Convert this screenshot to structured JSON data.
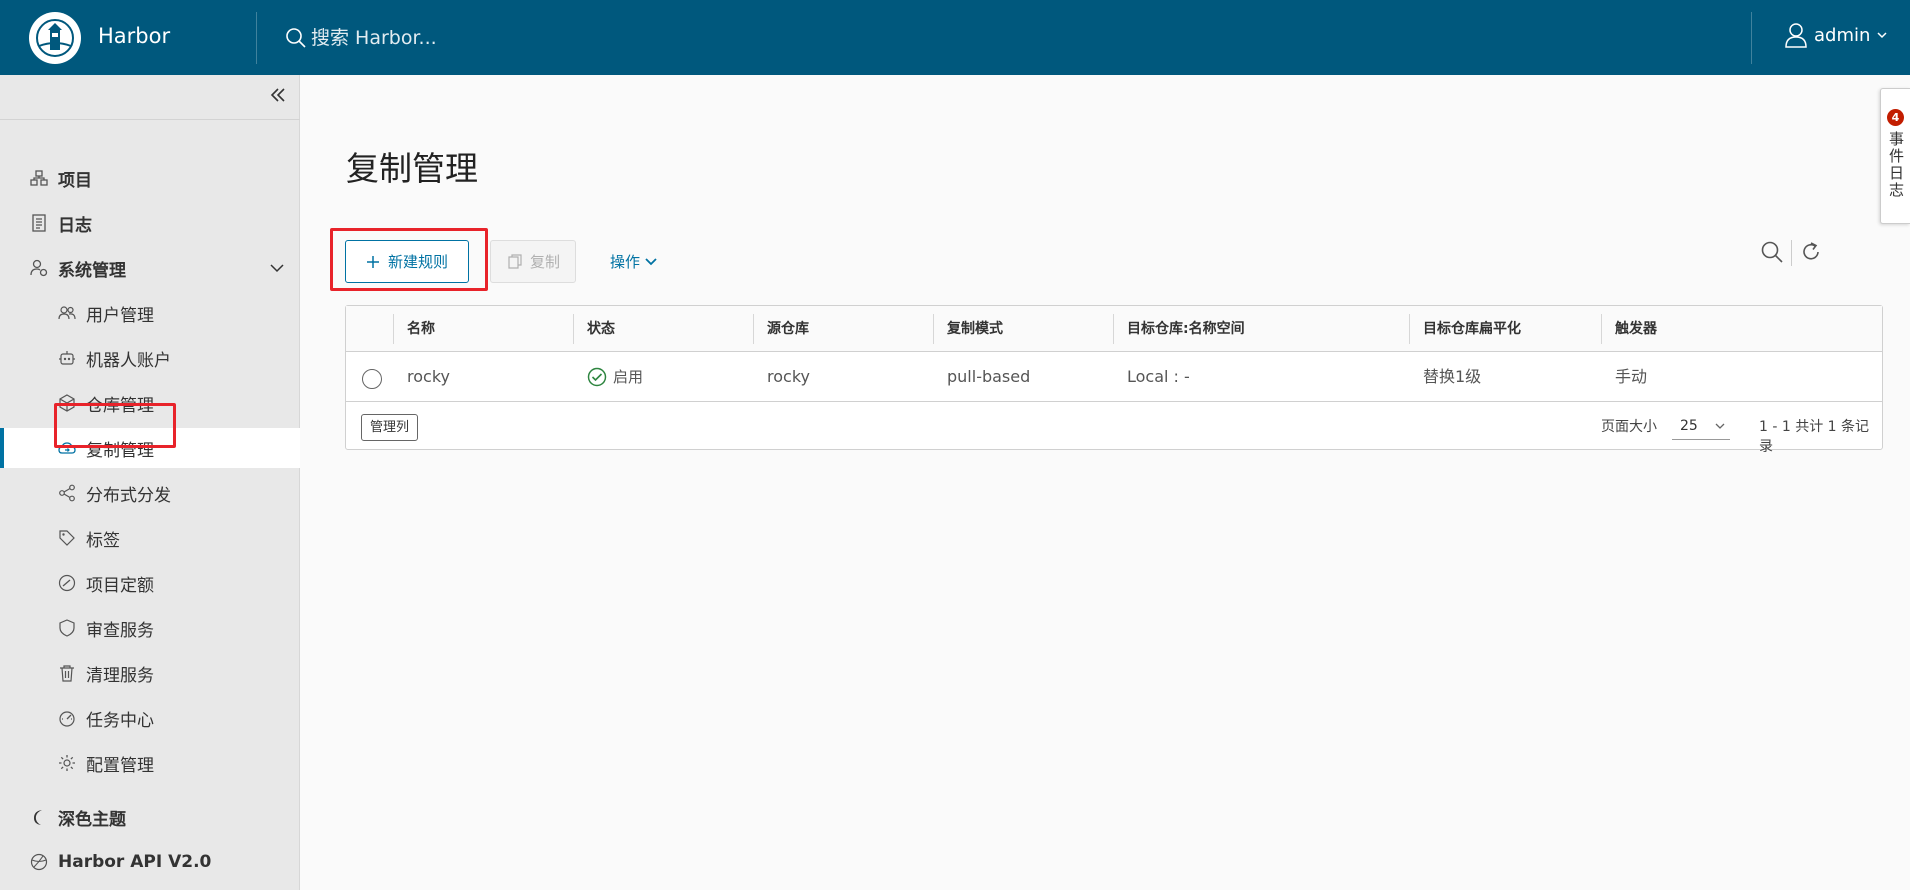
{
  "header": {
    "brand": "Harbor",
    "search_placeholder": "搜索 Harbor...",
    "user": "admin"
  },
  "sidebar": {
    "top": [
      {
        "label": "项目"
      },
      {
        "label": "日志"
      },
      {
        "label": "系统管理"
      }
    ],
    "sub": [
      {
        "label": "用户管理"
      },
      {
        "label": "机器人账户"
      },
      {
        "label": "仓库管理"
      },
      {
        "label": "复制管理"
      },
      {
        "label": "分布式分发"
      },
      {
        "label": "标签"
      },
      {
        "label": "项目定额"
      },
      {
        "label": "审查服务"
      },
      {
        "label": "清理服务"
      },
      {
        "label": "任务中心"
      },
      {
        "label": "配置管理"
      }
    ],
    "bottom": [
      {
        "label": "深色主题"
      },
      {
        "label": "Harbor API V2.0"
      }
    ]
  },
  "main": {
    "title": "复制管理",
    "new_rule": "新建规则",
    "copy": "复制",
    "actions": "操作"
  },
  "table": {
    "columns": [
      "名称",
      "状态",
      "源仓库",
      "复制模式",
      "目标仓库:名称空间",
      "目标仓库扁平化",
      "触发器"
    ],
    "rows": [
      {
        "name": "rocky",
        "status": "启用",
        "source": "rocky",
        "mode": "pull-based",
        "dest": "Local : -",
        "flatten": "替换1级",
        "trigger": "手动"
      }
    ],
    "manage_columns": "管理列",
    "page_size_label": "页面大小",
    "page_size": "25",
    "total": "1 - 1 共计 1 条记录"
  },
  "event_log": {
    "badge": "4",
    "label": "事件日志"
  },
  "colors": {
    "header": "#00587d",
    "accent": "#0072a3",
    "success": "#2e8540",
    "badge": "#c21d00",
    "highlight": "#e8232a"
  }
}
